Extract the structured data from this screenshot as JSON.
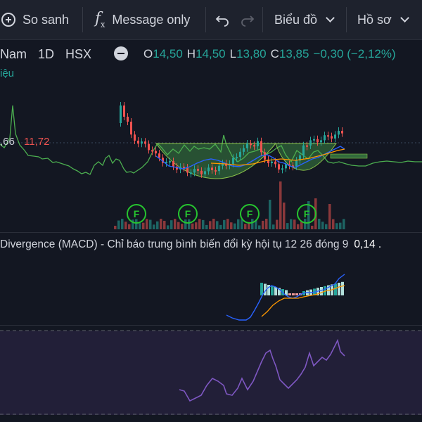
{
  "toolbar": {
    "compare_label": "So sanh",
    "indicator_label": "Message only",
    "chart_type_label": "Biểu đồ",
    "profile_label": "Hồ sơ",
    "icons": [
      "add-circle-icon",
      "function-icon",
      "undo-icon",
      "redo-icon",
      "chevron-down-icon"
    ]
  },
  "legend": {
    "exchange_suffix": "Nam",
    "interval": "1D",
    "exchange": "HSX",
    "open_label": "O",
    "open": "14,50",
    "high_label": "H",
    "high": "14,50",
    "low_label": "L",
    "low": "13,80",
    "close_label": "C",
    "close": "13,85",
    "change": "−0,30 (−2,12%)"
  },
  "unit_label": "iệu",
  "price_labels": {
    "left": ",66",
    "right": "11,72"
  },
  "macd": {
    "legend_text": "Divergence (MACD) - Chỉ báo trung bình biến đổi kỳ hội tụ 12 26 đóng 9",
    "value": "0,14 ."
  },
  "badges": [
    "F",
    "F",
    "F",
    "F"
  ],
  "colors": {
    "background": "#131722",
    "up": "#26a69a",
    "down": "#ef5350",
    "comparison_line": "#4caf50",
    "badge": "#26c42f",
    "macd_line": "#2962ff",
    "signal_line": "#ff9800",
    "rsi_line": "#7e57c2"
  }
}
